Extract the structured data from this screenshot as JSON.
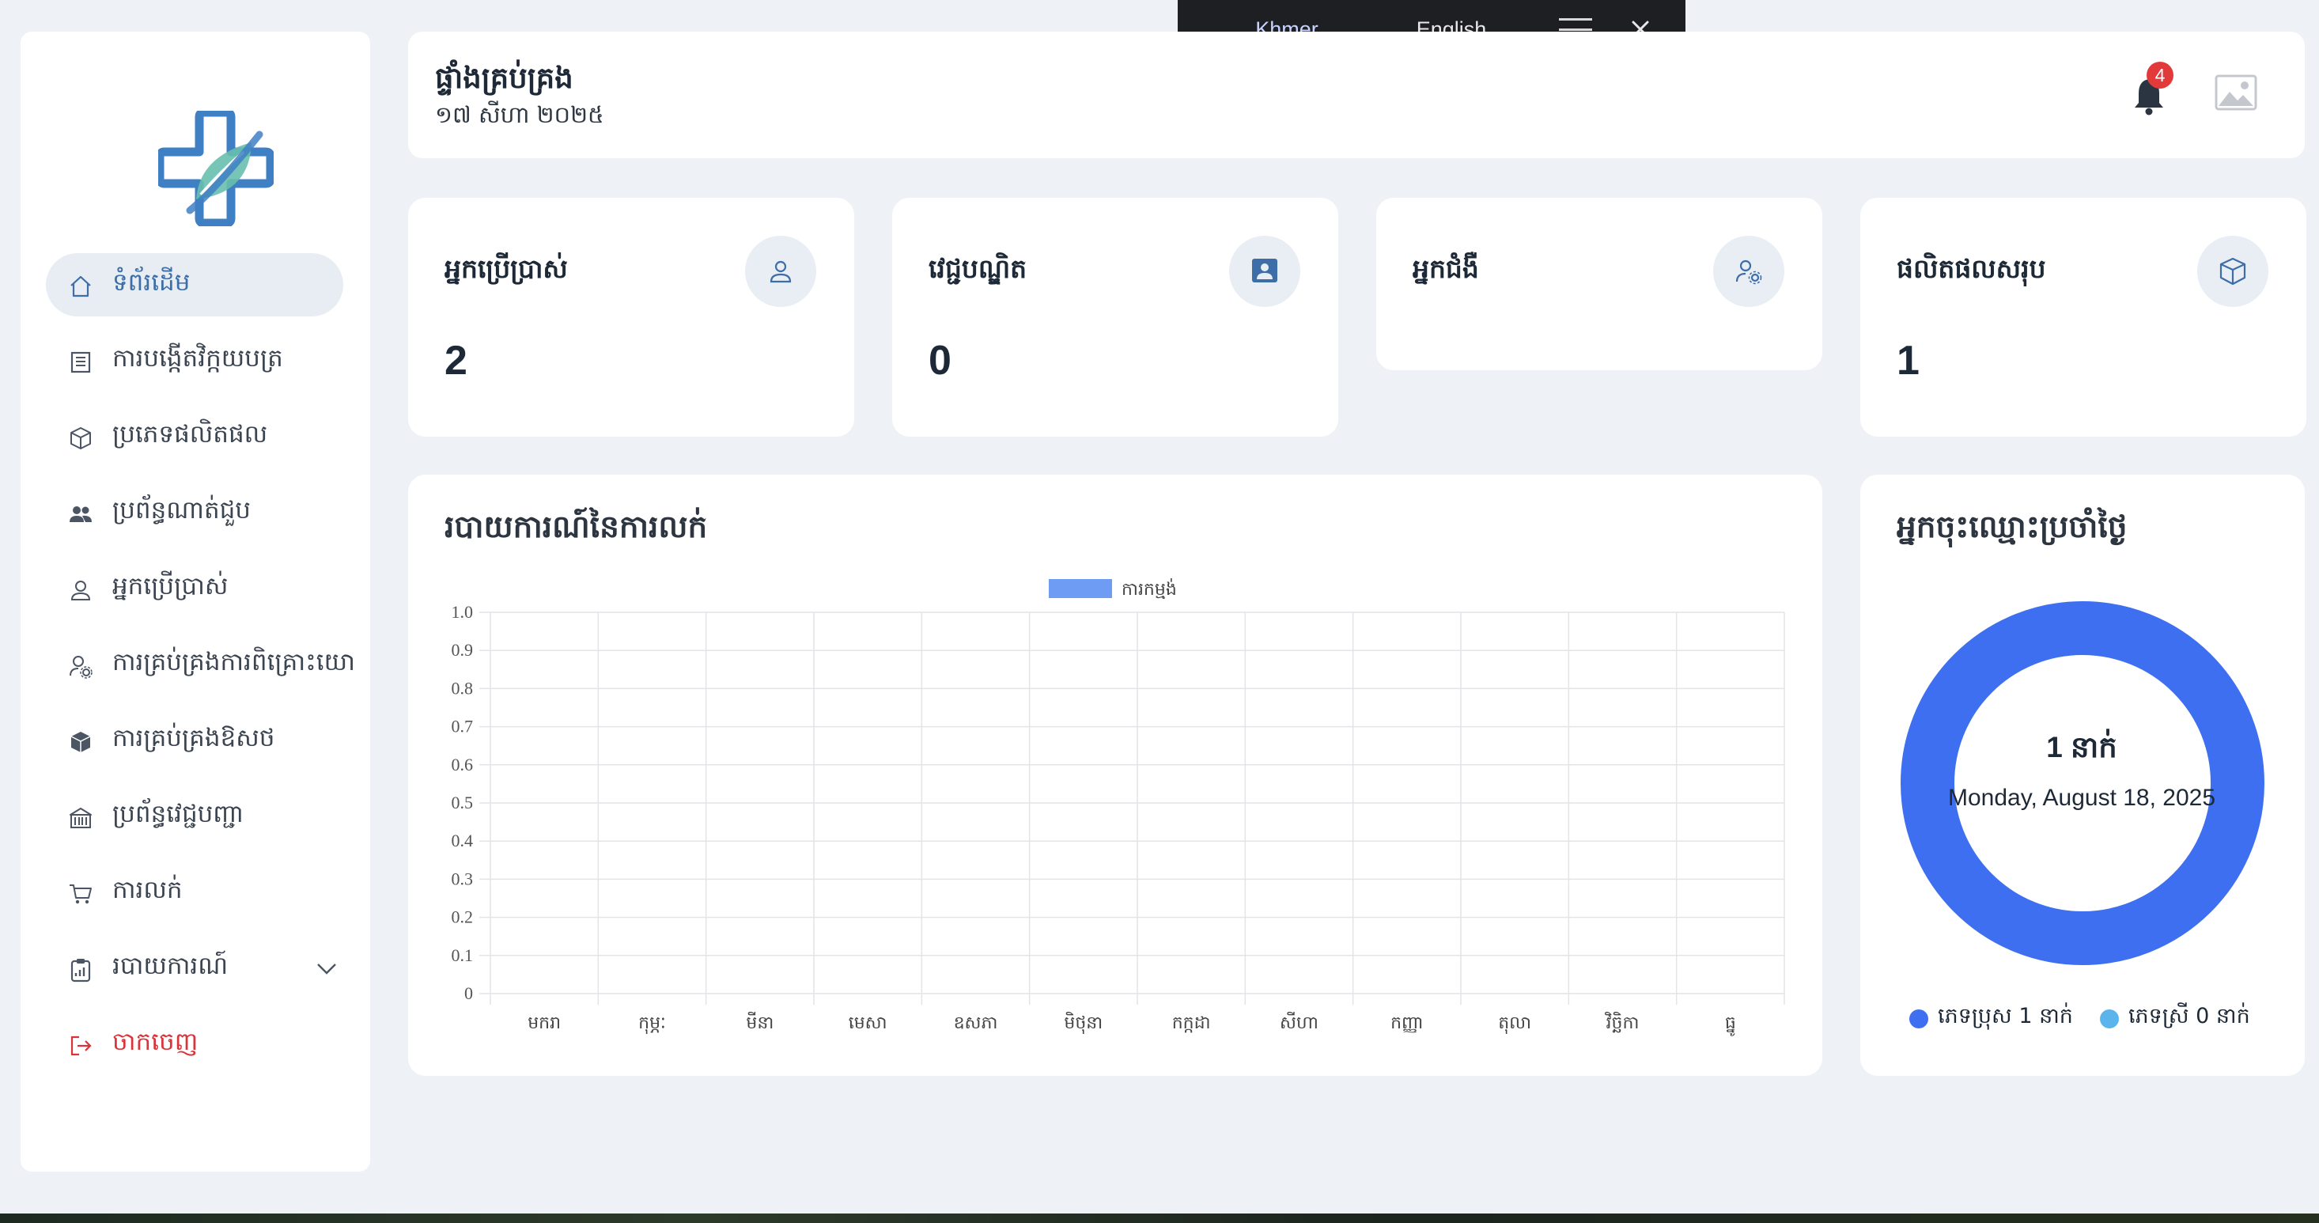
{
  "translate": {
    "tabs": [
      "Khmer",
      "English"
    ],
    "active_tab": "Khmer"
  },
  "sidebar": {
    "logo_icon": "medical-cross-leaf-logo",
    "items": [
      {
        "label": "ទំព័រដើម",
        "icon": "home-icon",
        "active": true
      },
      {
        "label": "ការបង្កើតវិក្កយបត្រ",
        "icon": "invoice-icon"
      },
      {
        "label": "ប្រភេទផលិតផល",
        "icon": "box-icon"
      },
      {
        "label": "ប្រព័ន្ធណាត់ជួប",
        "icon": "users-icon"
      },
      {
        "label": "អ្នកប្រើប្រាស់",
        "icon": "user-icon"
      },
      {
        "label": "ការគ្រប់គ្រងការពិគ្រោះយោ",
        "icon": "user-gear-icon"
      },
      {
        "label": "ការគ្រប់គ្រងឱសថ",
        "icon": "medicine-box-icon"
      },
      {
        "label": "ប្រព័ន្ធវេជ្ជបញ្ជា",
        "icon": "building-icon"
      },
      {
        "label": "ការលក់",
        "icon": "cart-icon"
      },
      {
        "label": "របាយការណ៍",
        "icon": "clipboard-icon",
        "expandable": true
      },
      {
        "label": "ចាកចេញ",
        "icon": "logout-icon",
        "danger": true
      }
    ]
  },
  "header": {
    "title": "ផ្ទាំងគ្រប់គ្រង",
    "date": "១៧ សីហា ២០២៥",
    "notification_count": "4"
  },
  "stats": [
    {
      "title": "អ្នកប្រើប្រាស់",
      "value": "2",
      "icon": "user-icon"
    },
    {
      "title": "វេជ្ជបណ្ឌិត",
      "value": "0",
      "icon": "doctor-icon"
    },
    {
      "title": "អ្នកជំងឺ",
      "value": "",
      "icon": "user-gear-icon"
    },
    {
      "title": "ផលិតផលសរុប",
      "value": "1",
      "icon": "box-icon"
    }
  ],
  "sales_report": {
    "title": "របាយការណ៍នៃការលក់",
    "colors": {
      "series": "#6e9bf4",
      "grid": "#e2e4e8"
    }
  },
  "chart_data": {
    "type": "bar",
    "title": "របាយការណ៍នៃការលក់",
    "categories": [
      "មករា",
      "កុម្ភៈ",
      "មីនា",
      "មេសា",
      "ឧសភា",
      "មិថុនា",
      "កក្កដា",
      "សីហា",
      "កញ្ញា",
      "តុលា",
      "វិច្ឆិកា",
      "ធ្នូ"
    ],
    "series": [
      {
        "name": "ការកម្មង់",
        "values": [
          0,
          0,
          0,
          0,
          0,
          0,
          0,
          0,
          0,
          0,
          0,
          0
        ]
      }
    ],
    "yticks": [
      "0",
      "0.1",
      "0.2",
      "0.3",
      "0.4",
      "0.5",
      "0.6",
      "0.7",
      "0.8",
      "0.9",
      "1.0"
    ],
    "ylim": [
      0,
      1.0
    ],
    "grid": true,
    "legend_position": "top-center"
  },
  "daily_registrations": {
    "title": "អ្នកចុះឈ្មោះប្រចាំថ្ងៃ",
    "center_count": "1 នាក់",
    "center_date": "Monday, August 18, 2025",
    "legend": [
      {
        "label": "ភេទប្រុស 1 នាក់",
        "color": "#3d6ff0",
        "value": 1
      },
      {
        "label": "ភេទស្រី 0 នាក់",
        "color": "#5bb4ec",
        "value": 0
      }
    ]
  }
}
